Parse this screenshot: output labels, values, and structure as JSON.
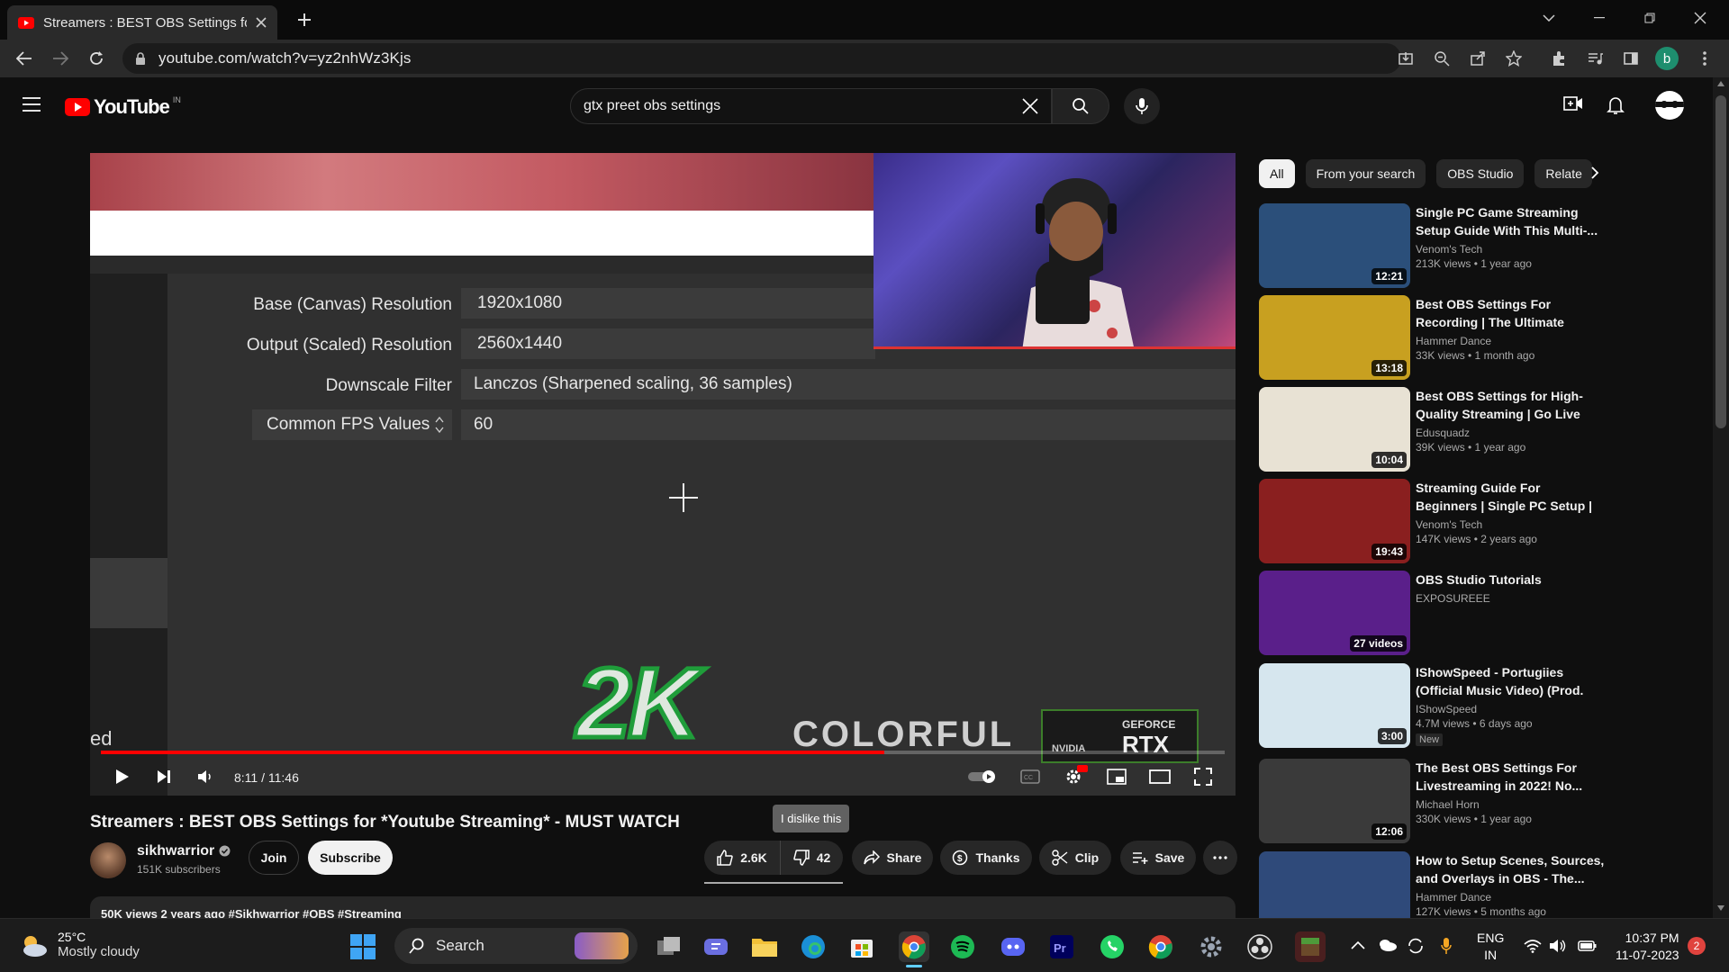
{
  "browser": {
    "tab_title": "Streamers : BEST OBS Settings fo",
    "url": "youtube.com/watch?v=yz2nhWz3Kjs",
    "profile_initial": "b"
  },
  "youtube": {
    "logo_text": "YouTube",
    "logo_region": "IN",
    "search_value": "gtx preet obs settings"
  },
  "video_frame": {
    "labels": [
      "Base (Canvas) Resolution",
      "Output (Scaled) Resolution",
      "Downscale Filter",
      "Common FPS Values"
    ],
    "values": [
      "1920x1080",
      "2560x1440",
      "Lanczos (Sharpened scaling, 36 samples)",
      "60"
    ],
    "overlay_2k": "2K",
    "overlay_brand": "COLORFUL",
    "nvidia_text": "NVIDIA",
    "geforce_text": "GEFORCE",
    "rtx_text": "RTX",
    "edge_text": "ed"
  },
  "player": {
    "time": "8:11 / 11:46",
    "progress_fraction": 0.697,
    "tooltip": "I dislike this"
  },
  "video": {
    "title": "Streamers : BEST OBS Settings for *Youtube Streaming* - MUST WATCH",
    "channel": "sikhwarrior",
    "subscribers": "151K subscribers",
    "join": "Join",
    "subscribe": "Subscribe",
    "likes": "2.6K",
    "dislikes": "42",
    "share": "Share",
    "thanks": "Thanks",
    "clip": "Clip",
    "save": "Save",
    "description_preview": "50K views  2 years ago  #Sikhwarrior #OBS #Streaming"
  },
  "sidebar": {
    "chips": [
      "All",
      "From your search",
      "OBS Studio",
      "Relate"
    ],
    "items": [
      {
        "title": "Single PC Game Streaming Setup Guide With This Multi-...",
        "channel": "Venom's Tech",
        "views": "213K views • 1 year ago",
        "duration": "12:21",
        "badge": "",
        "color": "#2b4f7a"
      },
      {
        "title": "Best OBS Settings For Recording | The Ultimate Guid...",
        "channel": "Hammer Dance",
        "views": "33K views • 1 month ago",
        "duration": "13:18",
        "badge": "",
        "color": "#c8a020"
      },
      {
        "title": "Best OBS Settings for High-Quality Streaming | Go Live wit...",
        "channel": "Edusquadz",
        "views": "39K views • 1 year ago",
        "duration": "10:04",
        "badge": "",
        "color": "#e8e2d4"
      },
      {
        "title": "Streaming Guide For Beginners | Single PC Setup | Everything...",
        "channel": "Venom's Tech",
        "views": "147K views • 2 years ago",
        "duration": "19:43",
        "badge": "",
        "color": "#8a1f1f"
      },
      {
        "title": "OBS Studio Tutorials",
        "channel": "EXPOSUREEE",
        "views": "",
        "duration": "27 videos",
        "badge": "",
        "color": "#5a1f8a"
      },
      {
        "title": "IShowSpeed - Portugiies (Official Music Video) (Prod. D...",
        "channel": "IShowSpeed",
        "views": "4.7M views • 6 days ago",
        "duration": "3:00",
        "badge": "New",
        "color": "#d6e6ee"
      },
      {
        "title": "The Best OBS Settings For Livestreaming in 2022! No...",
        "channel": "Michael Horn",
        "views": "330K views • 1 year ago",
        "duration": "12:06",
        "badge": "",
        "color": "#3a3a3a"
      },
      {
        "title": "How to Setup Scenes, Sources, and Overlays in OBS - The...",
        "channel": "Hammer Dance",
        "views": "127K views • 5 months ago",
        "duration": "",
        "badge": "",
        "color": "#2f4a7a"
      }
    ]
  },
  "taskbar": {
    "temp": "25°C",
    "weather": "Mostly cloudy",
    "search": "Search",
    "lang1": "ENG",
    "lang2": "IN",
    "time": "10:37 PM",
    "date": "11-07-2023",
    "notifications": "2"
  }
}
